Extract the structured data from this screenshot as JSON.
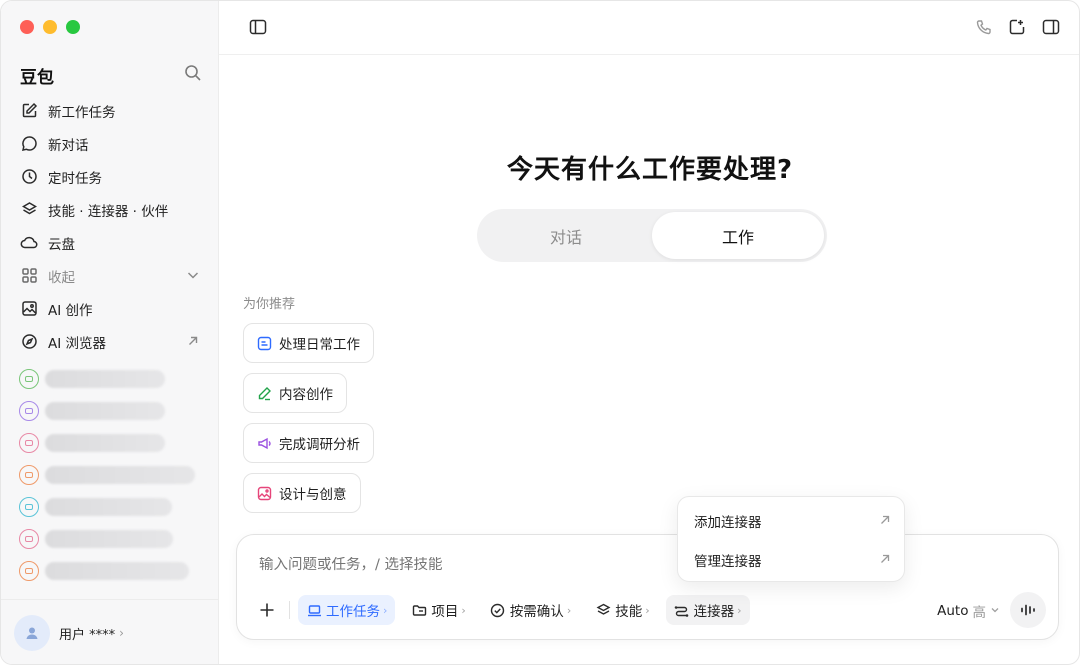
{
  "sidebar": {
    "brand": "豆包",
    "items": [
      {
        "label": "新工作任务",
        "icon": "edit-icon"
      },
      {
        "label": "新对话",
        "icon": "chat-bubble-icon"
      },
      {
        "label": "定时任务",
        "icon": "clock-icon"
      },
      {
        "label": "技能 · 连接器 · 伙伴",
        "icon": "layers-icon"
      },
      {
        "label": "云盘",
        "icon": "cloud-icon"
      },
      {
        "label": "收起",
        "icon": "grid-icon"
      },
      {
        "label": "AI 创作",
        "icon": "image-icon"
      },
      {
        "label": "AI 浏览器",
        "icon": "compass-icon"
      }
    ],
    "history_colors": [
      "#7bc67a",
      "#a88ae8",
      "#e889a6",
      "#ef9a6a",
      "#5bc4d8",
      "#e889a6",
      "#ef9a6a"
    ],
    "user": {
      "name": "用户 ****"
    }
  },
  "main": {
    "headline": "今天有什么工作要处理?",
    "modes": [
      "对话",
      "工作"
    ],
    "active_mode": "工作",
    "rec_label": "为你推荐",
    "recommendations": [
      {
        "label": "处理日常工作",
        "icon": "calendar-list-icon",
        "color": "#2f6bff"
      },
      {
        "label": "内容创作",
        "icon": "pen-icon",
        "color": "#22a34a"
      },
      {
        "label": "完成调研分析",
        "icon": "megaphone-icon",
        "color": "#9b51e0"
      },
      {
        "label": "设计与创意",
        "icon": "picture-icon",
        "color": "#e6457a"
      }
    ]
  },
  "composer": {
    "placeholder": "输入问题或任务，/ 选择技能",
    "tools": [
      {
        "label": "工作任务",
        "icon": "laptop-icon"
      },
      {
        "label": "项目",
        "icon": "folder-icon"
      },
      {
        "label": "按需确认",
        "icon": "check-circle-icon"
      },
      {
        "label": "技能",
        "icon": "layers-icon"
      },
      {
        "label": "连接器",
        "icon": "connector-icon"
      }
    ],
    "model": "Auto",
    "model_level": "高"
  },
  "dropdown": {
    "items": [
      "添加连接器",
      "管理连接器"
    ]
  },
  "colors": {
    "accent": "#2f6bff"
  }
}
